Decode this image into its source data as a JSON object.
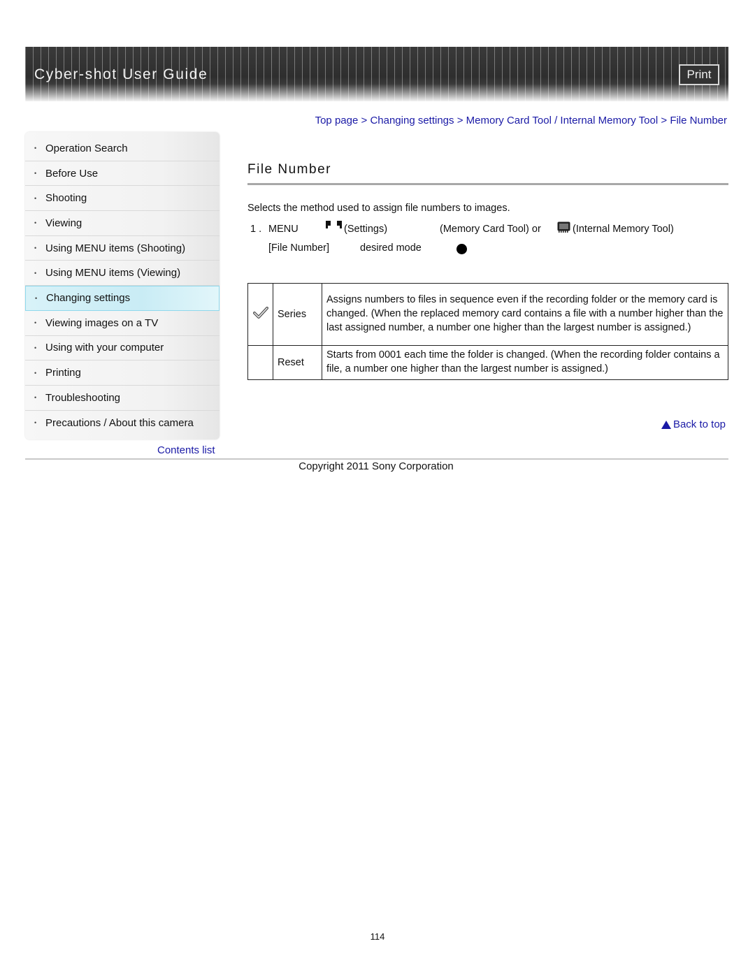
{
  "header": {
    "title": "Cyber-shot User Guide",
    "print_label": "Print"
  },
  "sidebar": {
    "items": [
      {
        "label": "Operation Search",
        "active": false
      },
      {
        "label": "Before Use",
        "active": false
      },
      {
        "label": "Shooting",
        "active": false
      },
      {
        "label": "Viewing",
        "active": false
      },
      {
        "label": "Using MENU items (Shooting)",
        "active": false
      },
      {
        "label": "Using MENU items (Viewing)",
        "active": false
      },
      {
        "label": "Changing settings",
        "active": true
      },
      {
        "label": "Viewing images on a TV",
        "active": false
      },
      {
        "label": "Using with your computer",
        "active": false
      },
      {
        "label": "Printing",
        "active": false
      },
      {
        "label": "Troubleshooting",
        "active": false
      },
      {
        "label": "Precautions / About this camera",
        "active": false
      }
    ],
    "bullet": "•",
    "contents_list": "Contents list"
  },
  "breadcrumb": {
    "items": [
      "Top page",
      "Changing settings",
      "Memory Card Tool / Internal Memory Tool",
      "File Number"
    ],
    "separator": " > "
  },
  "page": {
    "title": "File Number",
    "intro": "Selects the method used to assign file numbers to images.",
    "step": {
      "number": "1 .",
      "menu": "MENU",
      "settings": "(Settings)",
      "memory_card_tool": "(Memory Card Tool) or",
      "internal_memory_tool": "(Internal Memory Tool)",
      "file_number": "[File Number]",
      "desired_mode": "desired mode"
    },
    "modes": [
      {
        "name": "Series",
        "default": true,
        "icon": "checkmark-icon",
        "description": "Assigns numbers to files in sequence even if the recording folder or the memory card is changed. (When the replaced memory card contains a file with a number higher than the last assigned number, a number one higher than the largest number is assigned.)"
      },
      {
        "name": "Reset",
        "default": false,
        "icon": "",
        "description": "Starts from 0001 each time the folder is changed. (When the recording folder contains a file, a number one higher than the largest number is assigned.)"
      }
    ],
    "back_to_top": "Back to top"
  },
  "footer": {
    "copyright": "Copyright 2011 Sony Corporation",
    "page_number": "114"
  },
  "colors": {
    "link": "#1a1aa6",
    "active_nav": "#c9ecf5",
    "banner": "#2e2e2e"
  }
}
